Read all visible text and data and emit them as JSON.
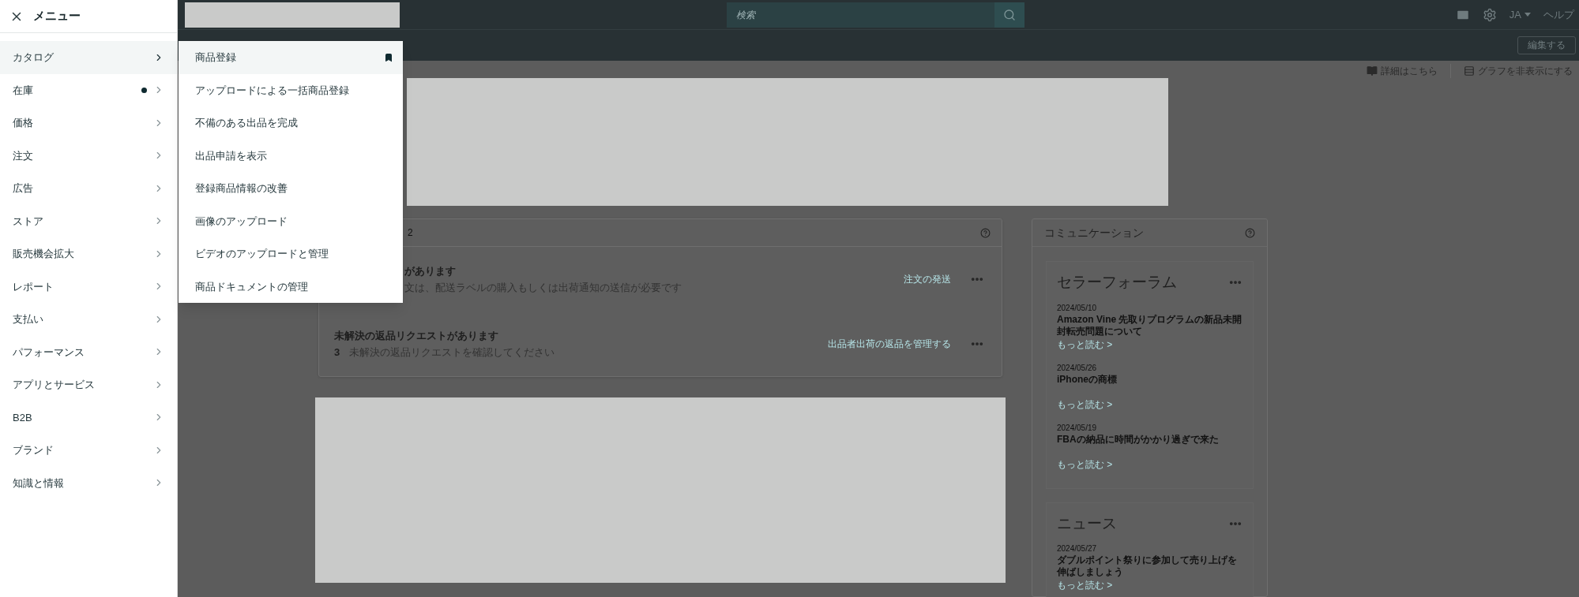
{
  "sidebar": {
    "title": "メニュー",
    "items": [
      {
        "label": "カタログ",
        "selected": true,
        "dot": false
      },
      {
        "label": "在庫",
        "selected": false,
        "dot": true
      },
      {
        "label": "価格",
        "selected": false,
        "dot": false
      },
      {
        "label": "注文",
        "selected": false,
        "dot": false
      },
      {
        "label": "広告",
        "selected": false,
        "dot": false
      },
      {
        "label": "ストア",
        "selected": false,
        "dot": false
      },
      {
        "label": "販売機会拡大",
        "selected": false,
        "dot": false
      },
      {
        "label": "レポート",
        "selected": false,
        "dot": false
      },
      {
        "label": "支払い",
        "selected": false,
        "dot": false
      },
      {
        "label": "パフォーマンス",
        "selected": false,
        "dot": false
      },
      {
        "label": "アプリとサービス",
        "selected": false,
        "dot": false
      },
      {
        "label": "B2B",
        "selected": false,
        "dot": false
      },
      {
        "label": "ブランド",
        "selected": false,
        "dot": false
      },
      {
        "label": "知識と情報",
        "selected": false,
        "dot": false
      }
    ]
  },
  "submenu": {
    "items": [
      {
        "label": "商品登録",
        "selected": true,
        "bookmarked": true
      },
      {
        "label": "アップロードによる一括商品登録",
        "selected": false,
        "bookmarked": false
      },
      {
        "label": "不備のある出品を完成",
        "selected": false,
        "bookmarked": false
      },
      {
        "label": "出品申請を表示",
        "selected": false,
        "bookmarked": false
      },
      {
        "label": "登録商品情報の改善",
        "selected": false,
        "bookmarked": false
      },
      {
        "label": "画像のアップロード",
        "selected": false,
        "bookmarked": false
      },
      {
        "label": "ビデオのアップロードと管理",
        "selected": false,
        "bookmarked": false
      },
      {
        "label": "商品ドキュメントの管理",
        "selected": false,
        "bookmarked": false
      }
    ]
  },
  "top_bar": {
    "search": {
      "placeholder": "検索"
    },
    "language": "JA",
    "help": "ヘルプ"
  },
  "sub_bar": {
    "edit_button": "編集する"
  },
  "toolbar": {
    "details_link": "詳細はこちら",
    "hide_graph": "グラフを非表示にする"
  },
  "actions_card": {
    "count": "2",
    "rows": [
      {
        "title": "があります",
        "description": "文は、配送ラベルの購入もしくは出荷通知の送信が必要です",
        "link": "注文の発送"
      },
      {
        "title": "未解決の返品リクエストがあります",
        "count": "3",
        "description": "未解決の返品リクエストを確認してください",
        "link": "出品者出荷の返品を管理する"
      }
    ]
  },
  "communication": {
    "title": "コミュニケーション",
    "sections": [
      {
        "title": "セラーフォーラム",
        "posts": [
          {
            "date": "2024/05/10",
            "title": "Amazon Vine 先取りプログラムの新品未開封転売問題について",
            "link": "もっと読む >"
          },
          {
            "date": "2024/05/26",
            "title": "iPhoneの商標",
            "link": "もっと読む >"
          },
          {
            "date": "2024/05/19",
            "title": "FBAの納品に時間がかかり過ぎで来た",
            "link": "もっと読む >"
          }
        ]
      },
      {
        "title": "ニュース",
        "posts": [
          {
            "date": "2024/05/27",
            "title": "ダブルポイント祭りに参加して売り上げを伸ばしましょう",
            "link": "もっと読む >"
          }
        ]
      }
    ]
  }
}
